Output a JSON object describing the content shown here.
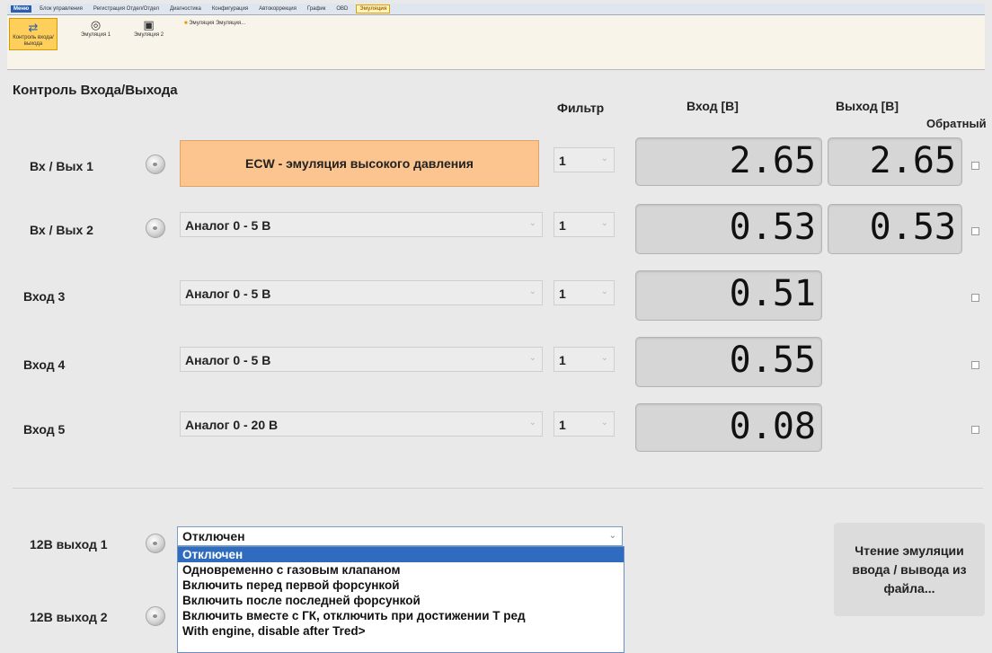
{
  "tabs": [
    "Меню",
    "Блок управления",
    "Регистрация Отдел/Отдел",
    "Диагностика",
    "Конфигурация",
    "Автокоррекция",
    "График",
    "OBD",
    "Эмуляция"
  ],
  "ribbon": {
    "btn_control": "Контроль входа/выхода",
    "btn_emulation1": "Эмуляция 1",
    "btn_emulation2": "Эмуляция 2",
    "label": "Эмуляция Эмуляция..."
  },
  "panel": {
    "title": "Контроль Входа/Выхода",
    "col_filter": "Фильтр",
    "col_input": "Вход [В]",
    "col_output": "Выход [В]",
    "col_reverse": "Обратный"
  },
  "rows": [
    {
      "label": "Вх / Вых 1",
      "mode": "ECW - эмуляция высокого давления",
      "filter": "1",
      "input": "2.65",
      "output": "2.65"
    },
    {
      "label": "Вх / Вых 2",
      "mode": "Аналог 0 - 5 В",
      "filter": "1",
      "input": "0.53",
      "output": "0.53"
    },
    {
      "label": "Вход 3",
      "mode": "Аналог 0 - 5 В",
      "filter": "1",
      "input": "0.51"
    },
    {
      "label": "Вход 4",
      "mode": "Аналог 0 - 5 В",
      "filter": "1",
      "input": "0.55"
    },
    {
      "label": "Вход 5",
      "mode": "Аналог 0 - 20 В",
      "filter": "1",
      "input": "0.08"
    }
  ],
  "outputs12v": {
    "label1": "12В выход 1",
    "label2": "12В выход 2",
    "selected": "Отключен",
    "options": [
      "Отключен",
      "Одновременно с газовым клапаном",
      "Включить перед первой форсункой",
      "Включить после последней форсункой",
      "Включить вместе с ГК, отключить при достижении Т ред",
      "With engine, disable after Tred>"
    ]
  },
  "read_button": {
    "line1": "Чтение эмуляции",
    "line2": "ввода / вывода из",
    "line3": "файла..."
  }
}
